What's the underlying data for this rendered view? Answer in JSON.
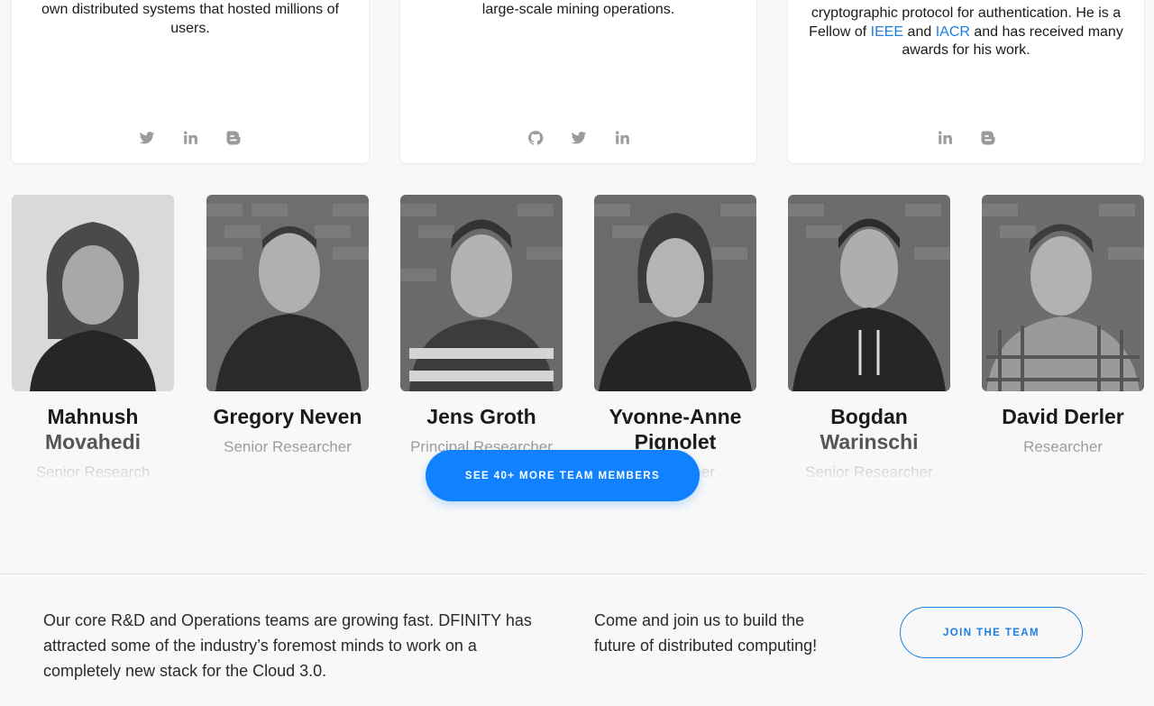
{
  "cards": [
    {
      "bio_lines": [
        "own distributed systems that hosted millions of",
        "users."
      ],
      "socials": [
        "twitter-icon",
        "linkedin-icon",
        "blogger-icon"
      ]
    },
    {
      "bio_lines": [
        "large-scale mining operations."
      ],
      "socials": [
        "github-icon",
        "twitter-icon",
        "linkedin-icon"
      ]
    },
    {
      "bio_pre": "cryptographic protocol for authentication. He is a",
      "bio_mid_1": "Fellow of ",
      "link_1": "IEEE",
      "bio_mid_2": " and ",
      "link_2": "IACR",
      "bio_mid_3": " and has received many",
      "bio_end": "awards for his work.",
      "socials": [
        "linkedin-icon",
        "blogger-icon"
      ]
    }
  ],
  "team": [
    {
      "first": "Mahnush",
      "second": "Movahedi",
      "role": "Senior Research"
    },
    {
      "first": "Gregory Neven",
      "second": "",
      "role": "Senior Researcher"
    },
    {
      "first": "Jens Groth",
      "second": "",
      "role": "Principal Researcher"
    },
    {
      "first": "Yvonne-Anne",
      "second": "Pignolet",
      "role": "Researcher"
    },
    {
      "first": "Bogdan",
      "second": "Warinschi",
      "role": "Senior Researcher"
    },
    {
      "first": "David Derler",
      "second": "",
      "role": "Researcher"
    }
  ],
  "see_more_label": "SEE 40+ MORE TEAM MEMBERS",
  "footer": {
    "left_lines": [
      "Our core R&D and Operations teams are growing fast. DFINITY has",
      "attracted some of the industry’s foremost minds to work on a",
      "completely new stack for the Cloud 3.0."
    ],
    "mid_lines": [
      "Come and join us to build the",
      "future of distributed computing!"
    ],
    "join_label": "JOIN THE TEAM"
  },
  "colors": {
    "accent": "#1181ff",
    "link": "#1b7fe0",
    "icon_gray": "#9b9b9b"
  }
}
